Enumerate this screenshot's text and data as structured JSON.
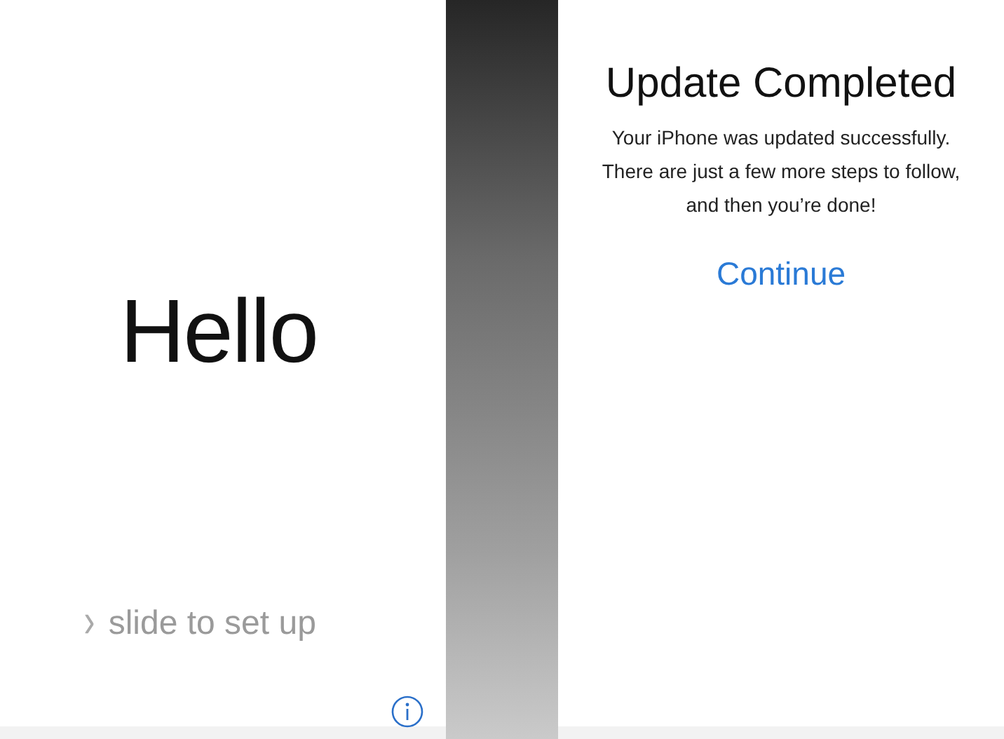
{
  "hello_screen": {
    "greeting": "Hello",
    "slide_hint": {
      "arrow": "›",
      "label": "slide to set up"
    }
  },
  "update_screen": {
    "title": "Update Completed",
    "message": "Your iPhone was updated successfully. There are just a few more steps to follow, and then you’re done!",
    "continue_button": "Continue"
  }
}
